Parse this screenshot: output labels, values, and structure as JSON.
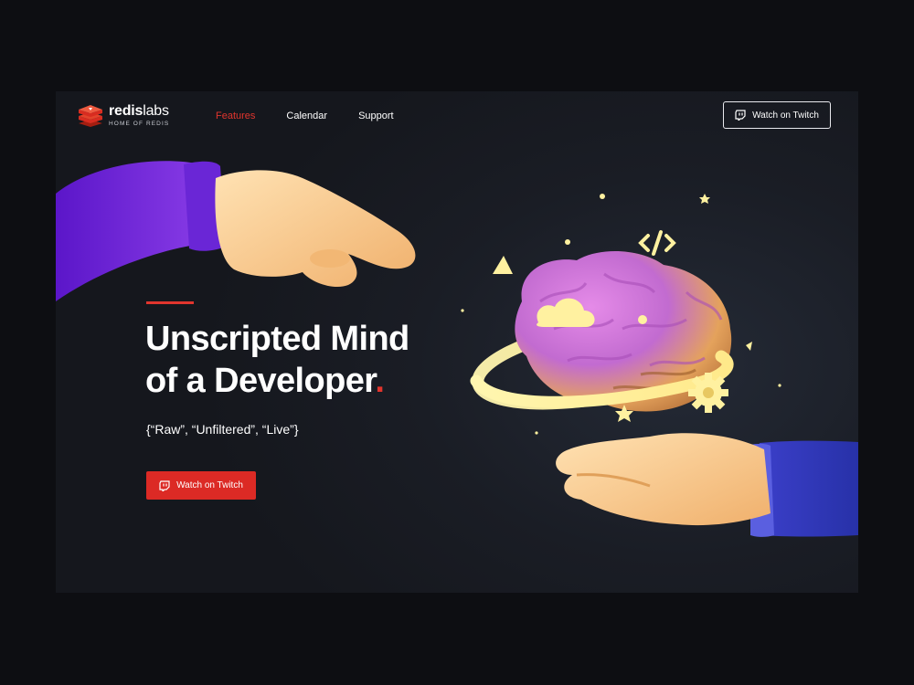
{
  "brand": {
    "name_bold": "redis",
    "name_light": "labs",
    "tagline": "HOME OF REDIS",
    "logo_icon": "redis-cube-icon",
    "accent_color": "#e1352d"
  },
  "nav": {
    "items": [
      {
        "label": "Features",
        "active": true
      },
      {
        "label": "Calendar",
        "active": false
      },
      {
        "label": "Support",
        "active": false
      }
    ]
  },
  "header_cta": {
    "label": "Watch on Twitch",
    "icon": "twitch-icon"
  },
  "hero": {
    "headline_line1": "Unscripted Mind",
    "headline_line2": "of a Developer",
    "headline_dot": ".",
    "subline": "{“Raw”, “Unfiltered”, “Live”}",
    "cta_label": "Watch on Twitch",
    "cta_icon": "twitch-icon",
    "cta_color": "#dc2a25"
  }
}
